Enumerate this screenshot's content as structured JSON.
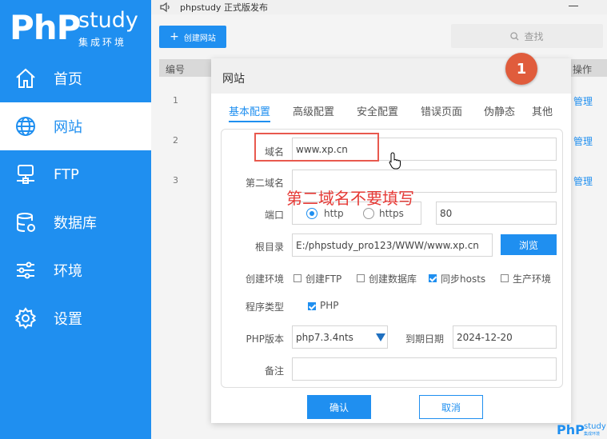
{
  "app": {
    "logo_php": "PhP",
    "logo_study": "study",
    "logo_sub": "集成环境"
  },
  "sidebar": {
    "items": [
      {
        "label": "首页",
        "icon": "home-icon",
        "active": false
      },
      {
        "label": "网站",
        "icon": "globe-icon",
        "active": true
      },
      {
        "label": "FTP",
        "icon": "ftp-icon",
        "active": false
      },
      {
        "label": "数据库",
        "icon": "database-icon",
        "active": false
      },
      {
        "label": "环境",
        "icon": "sliders-icon",
        "active": false
      },
      {
        "label": "设置",
        "icon": "gear-icon",
        "active": false
      }
    ]
  },
  "topbar": {
    "announcement": "phpstudy 正式版发布"
  },
  "toolbar": {
    "add_site_label": "创建网站",
    "search_placeholder": "查找"
  },
  "table": {
    "header_number": "编号",
    "header_actions": "操作",
    "rows": [
      {
        "number": "1",
        "action": "管理"
      },
      {
        "number": "2",
        "action": "管理"
      },
      {
        "number": "3",
        "action": "管理"
      }
    ]
  },
  "dialog": {
    "title": "网站",
    "tabs": [
      "基本配置",
      "高级配置",
      "安全配置",
      "错误页面",
      "伪静态",
      "其他"
    ],
    "active_tab": 0,
    "fields": {
      "domain_label": "域名",
      "domain_value": "www.xp.cn",
      "second_domain_label": "第二域名",
      "second_domain_value": "",
      "port_label": "端口",
      "http_label": "http",
      "https_label": "https",
      "protocol_selected": "http",
      "port_value": "80",
      "root_label": "根目录",
      "root_value": "E:/phpstudy_pro123/WWW/www.xp.cn",
      "browse_label": "浏览",
      "env_label": "创建环境",
      "env_options": [
        {
          "label": "创建FTP",
          "checked": false
        },
        {
          "label": "创建数据库",
          "checked": false
        },
        {
          "label": "同步hosts",
          "checked": true
        },
        {
          "label": "生产环境",
          "checked": false
        }
      ],
      "program_type_label": "程序类型",
      "program_type_option": "PHP",
      "program_type_checked": true,
      "php_version_label": "PHP版本",
      "php_version_value": "php7.3.4nts",
      "expiry_label": "到期日期",
      "expiry_value": "2024-12-20",
      "remark_label": "备注",
      "remark_value": ""
    },
    "confirm_label": "确认",
    "cancel_label": "取消"
  },
  "annotations": {
    "badge_number": "1",
    "note": "第二域名不要填写",
    "note_color": "#e53935",
    "highlight_color": "#e8594e"
  },
  "corner_logo": {
    "php": "PhP",
    "study": "study",
    "sub": "集成环境"
  },
  "colors": {
    "accent": "#1f8ff0",
    "badge": "#e05c3c"
  }
}
